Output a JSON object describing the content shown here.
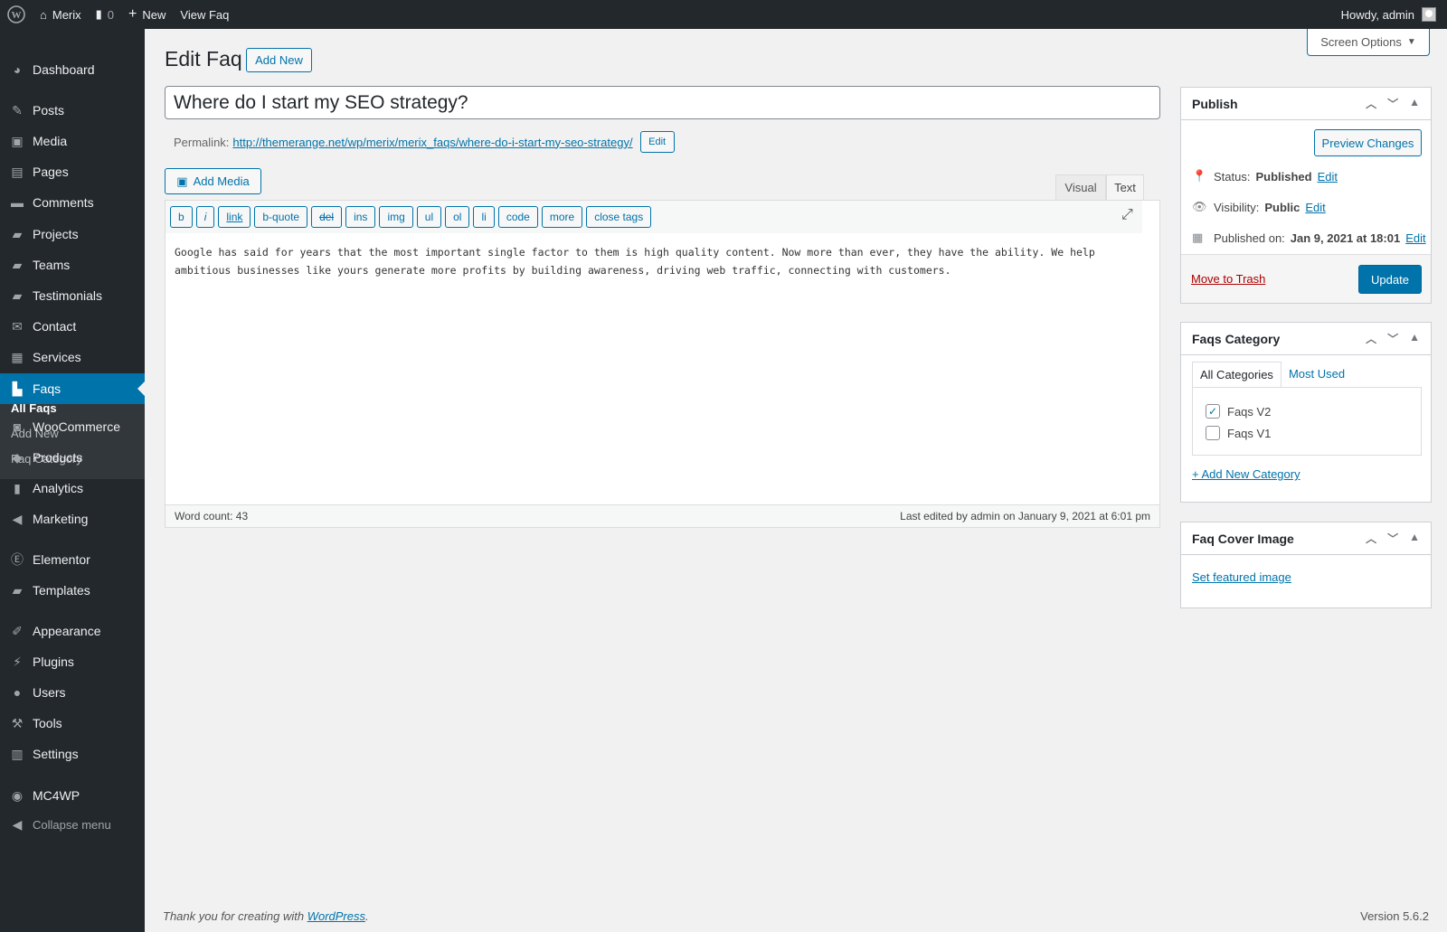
{
  "adminbar": {
    "site_name": "Merix",
    "comments_count": "0",
    "new_label": "New",
    "view_label": "View Faq",
    "howdy": "Howdy, admin"
  },
  "sidebar": {
    "items": [
      {
        "label": "Dashboard",
        "icon": "dashboard-icon"
      },
      {
        "label": "Posts",
        "icon": "pin-icon"
      },
      {
        "label": "Media",
        "icon": "media-icon"
      },
      {
        "label": "Pages",
        "icon": "pages-icon"
      },
      {
        "label": "Comments",
        "icon": "comments-icon"
      },
      {
        "label": "Projects",
        "icon": "folder-icon"
      },
      {
        "label": "Teams",
        "icon": "folder-icon"
      },
      {
        "label": "Testimonials",
        "icon": "folder-icon"
      },
      {
        "label": "Contact",
        "icon": "mail-icon"
      },
      {
        "label": "Services",
        "icon": "briefcase-icon"
      },
      {
        "label": "Faqs",
        "icon": "store-icon"
      },
      {
        "label": "WooCommerce",
        "icon": "woo-icon"
      },
      {
        "label": "Products",
        "icon": "products-icon"
      },
      {
        "label": "Analytics",
        "icon": "chart-icon"
      },
      {
        "label": "Marketing",
        "icon": "megaphone-icon"
      },
      {
        "label": "Elementor",
        "icon": "elementor-icon"
      },
      {
        "label": "Templates",
        "icon": "folder-icon"
      },
      {
        "label": "Appearance",
        "icon": "brush-icon"
      },
      {
        "label": "Plugins",
        "icon": "plugin-icon"
      },
      {
        "label": "Users",
        "icon": "user-icon"
      },
      {
        "label": "Tools",
        "icon": "wrench-icon"
      },
      {
        "label": "Settings",
        "icon": "settings-icon"
      },
      {
        "label": "MC4WP",
        "icon": "mc4wp-icon"
      },
      {
        "label": "Collapse menu",
        "icon": "collapse-icon"
      }
    ],
    "submenu": [
      "All Faqs",
      "Add New",
      "Faq Category"
    ]
  },
  "page": {
    "title": "Edit Faq",
    "add_new": "Add New",
    "screen_options": "Screen Options",
    "post_title": "Where do I start my SEO strategy?",
    "permalink_label": "Permalink:",
    "permalink_base": "http://themerange.net/wp/merix/merix_faqs/",
    "permalink_slug": "where-do-i-start-my-seo-strategy/",
    "permalink_edit": "Edit",
    "add_media": "Add Media",
    "tab_visual": "Visual",
    "tab_text": "Text",
    "quicktags": [
      "b",
      "i",
      "link",
      "b-quote",
      "del",
      "ins",
      "img",
      "ul",
      "ol",
      "li",
      "code",
      "more",
      "close tags"
    ],
    "content_line1": "Google has said for years that the most important single factor to them is high quality content. Now more than ever, they have the ability. We help",
    "content_line2": "ambitious businesses like yours generate more profits by building awareness, driving web traffic, connecting with customers.",
    "word_count": "Word count: 43",
    "last_edited": "Last edited by admin on January 9, 2021 at 6:01 pm"
  },
  "publish": {
    "title": "Publish",
    "preview": "Preview Changes",
    "status_label": "Status:",
    "status_value": "Published",
    "visibility_label": "Visibility:",
    "visibility_value": "Public",
    "published_label": "Published on:",
    "published_value": "Jan 9, 2021 at 18:01",
    "edit": "Edit",
    "trash": "Move to Trash",
    "update": "Update"
  },
  "category": {
    "title": "Faqs Category",
    "tab_all": "All Categories",
    "tab_used": "Most Used",
    "items": [
      {
        "label": "Faqs V2",
        "checked": true
      },
      {
        "label": "Faqs V1",
        "checked": false
      }
    ],
    "add_new": "+ Add New Category"
  },
  "cover": {
    "title": "Faq Cover Image",
    "set_featured": "Set featured image"
  },
  "footer": {
    "thanks_prefix": "Thank you for creating with ",
    "wordpress": "WordPress",
    "thanks_suffix": ".",
    "version": "Version 5.6.2"
  }
}
